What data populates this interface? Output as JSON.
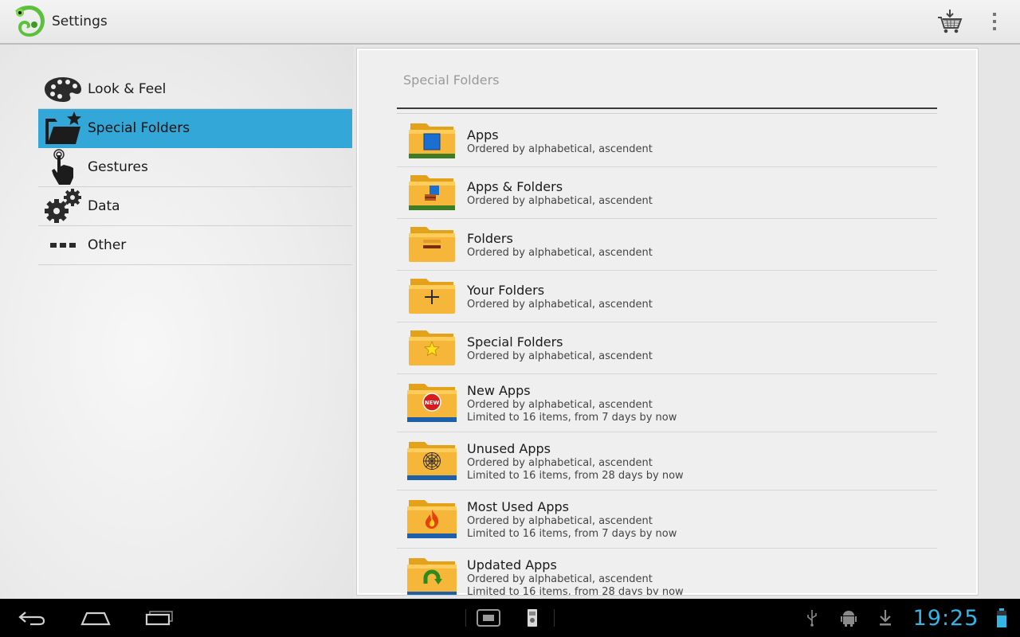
{
  "action_bar": {
    "title": "Settings",
    "logo_icon": "chameleon-logo-icon",
    "cart_icon": "shopping-cart-icon",
    "overflow_icon": "overflow-menu-icon"
  },
  "nav": {
    "items": [
      {
        "label": "Look & Feel",
        "icon": "palette-icon",
        "selected": false
      },
      {
        "label": "Special Folders",
        "icon": "folder-star-icon",
        "selected": true
      },
      {
        "label": "Gestures",
        "icon": "hand-touch-icon",
        "selected": false
      },
      {
        "label": "Data",
        "icon": "gears-icon",
        "selected": false
      },
      {
        "label": "Other",
        "icon": "dots-icon",
        "selected": false
      }
    ],
    "selected_color": "#33a8d8"
  },
  "main": {
    "section_title": "Special Folders",
    "folders": [
      {
        "name": "Apps",
        "order": "Ordered by alphabetical, ascendent",
        "limit": ""
      },
      {
        "name": "Apps & Folders",
        "order": "Ordered by alphabetical, ascendent",
        "limit": ""
      },
      {
        "name": "Folders",
        "order": "Ordered by alphabetical, ascendent",
        "limit": ""
      },
      {
        "name": "Your Folders",
        "order": "Ordered by alphabetical, ascendent",
        "limit": ""
      },
      {
        "name": "Special Folders",
        "order": "Ordered by alphabetical, ascendent",
        "limit": ""
      },
      {
        "name": "New Apps",
        "order": "Ordered by alphabetical, ascendent",
        "limit": "Limited to 16 items, from 7 days by now",
        "badge": "NEW"
      },
      {
        "name": "Unused Apps",
        "order": "Ordered by alphabetical, ascendent",
        "limit": "Limited to 16 items, from 28 days by now"
      },
      {
        "name": "Most Used Apps",
        "order": "Ordered by alphabetical, ascendent",
        "limit": "Limited to 16 items, from 7 days by now"
      },
      {
        "name": "Updated Apps",
        "order": "Ordered by alphabetical, ascendent",
        "limit": "Limited to 16 items, from 28 days by now"
      }
    ]
  },
  "system_bar": {
    "clock": "19:25",
    "accent": "#33b5e5"
  }
}
